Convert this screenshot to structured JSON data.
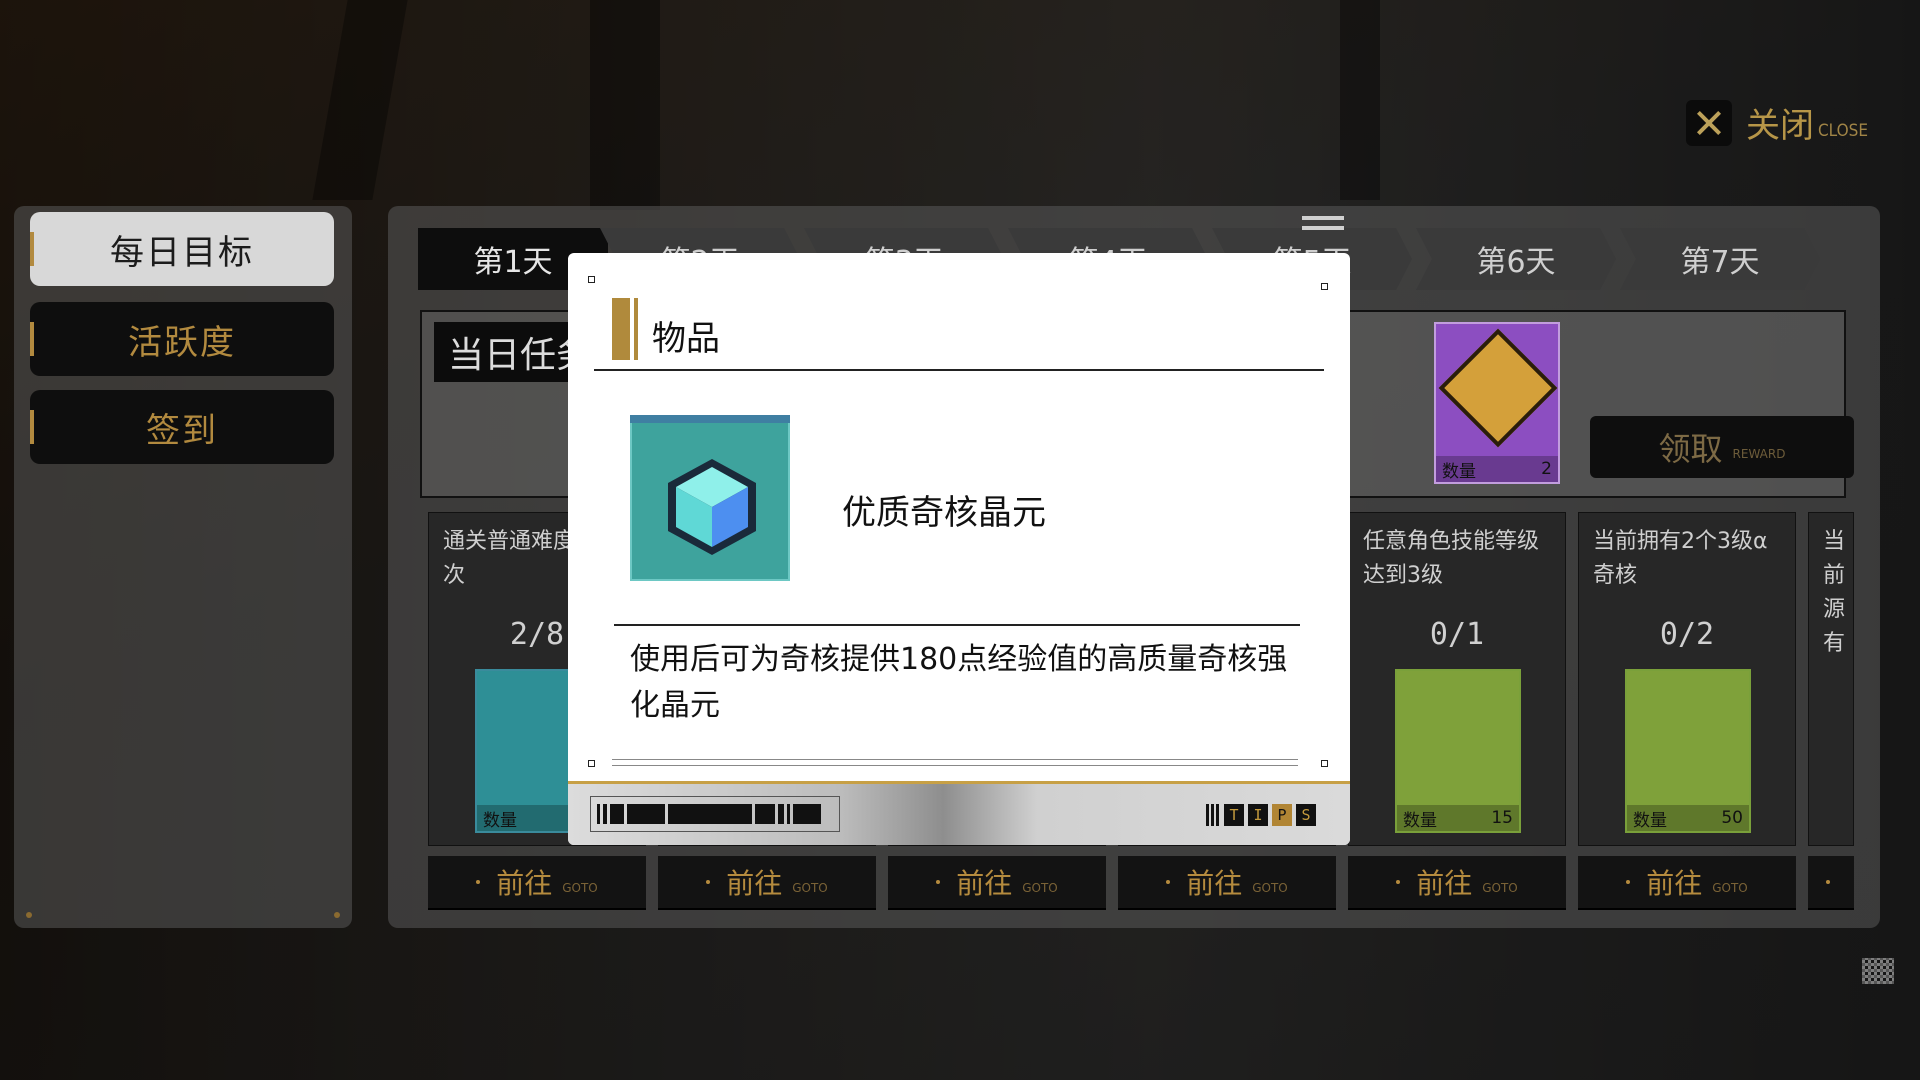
{
  "header": {
    "close_label": "关闭",
    "close_sub": "CLOSE"
  },
  "sidebar": {
    "items": [
      {
        "label": "每日目标",
        "active": true
      },
      {
        "label": "活跃度",
        "active": false
      },
      {
        "label": "签到",
        "active": false
      }
    ]
  },
  "tabs": [
    {
      "label": "第1天",
      "active": true
    },
    {
      "label": "第2天",
      "active": false
    },
    {
      "label": "第3天",
      "active": false
    },
    {
      "label": "第4天",
      "active": false
    },
    {
      "label": "第5天",
      "active": false
    },
    {
      "label": "第6天",
      "active": false
    },
    {
      "label": "第7天",
      "active": false
    }
  ],
  "daily": {
    "title": "当日任务",
    "reward_qty_label": "数量",
    "reward_qty": "2",
    "claim_label": "领取",
    "claim_sub": "REWARD"
  },
  "tasks": [
    {
      "text": "通关普通难度关卡8次",
      "progress": "2/8",
      "qty_label": "数量",
      "qty": ""
    },
    {
      "text": "",
      "progress": "",
      "qty_label": "",
      "qty": ""
    },
    {
      "text": "",
      "progress": "",
      "qty_label": "",
      "qty": ""
    },
    {
      "text": "",
      "progress": "",
      "qty_label": "",
      "qty": ""
    },
    {
      "text": "任意角色技能等级达到3级",
      "progress": "0/1",
      "qty_label": "数量",
      "qty": "15"
    },
    {
      "text": "当前拥有2个3级α奇核",
      "progress": "0/2",
      "qty_label": "数量",
      "qty": "50"
    },
    {
      "text": "当前源有",
      "progress": "",
      "qty_label": "",
      "qty": ""
    }
  ],
  "goto": {
    "label": "前往",
    "sub": "GOTO"
  },
  "modal": {
    "title": "物品",
    "item_name": "优质奇核晶元",
    "description": "使用后可为奇核提供180点经验值的高质量奇核强化晶元",
    "tips": [
      "T",
      "I",
      "P",
      "S"
    ]
  },
  "colors": {
    "accent_gold": "#b28a3f",
    "item_teal": "#3ea39d",
    "reward_purple": "#8c4ec1"
  }
}
